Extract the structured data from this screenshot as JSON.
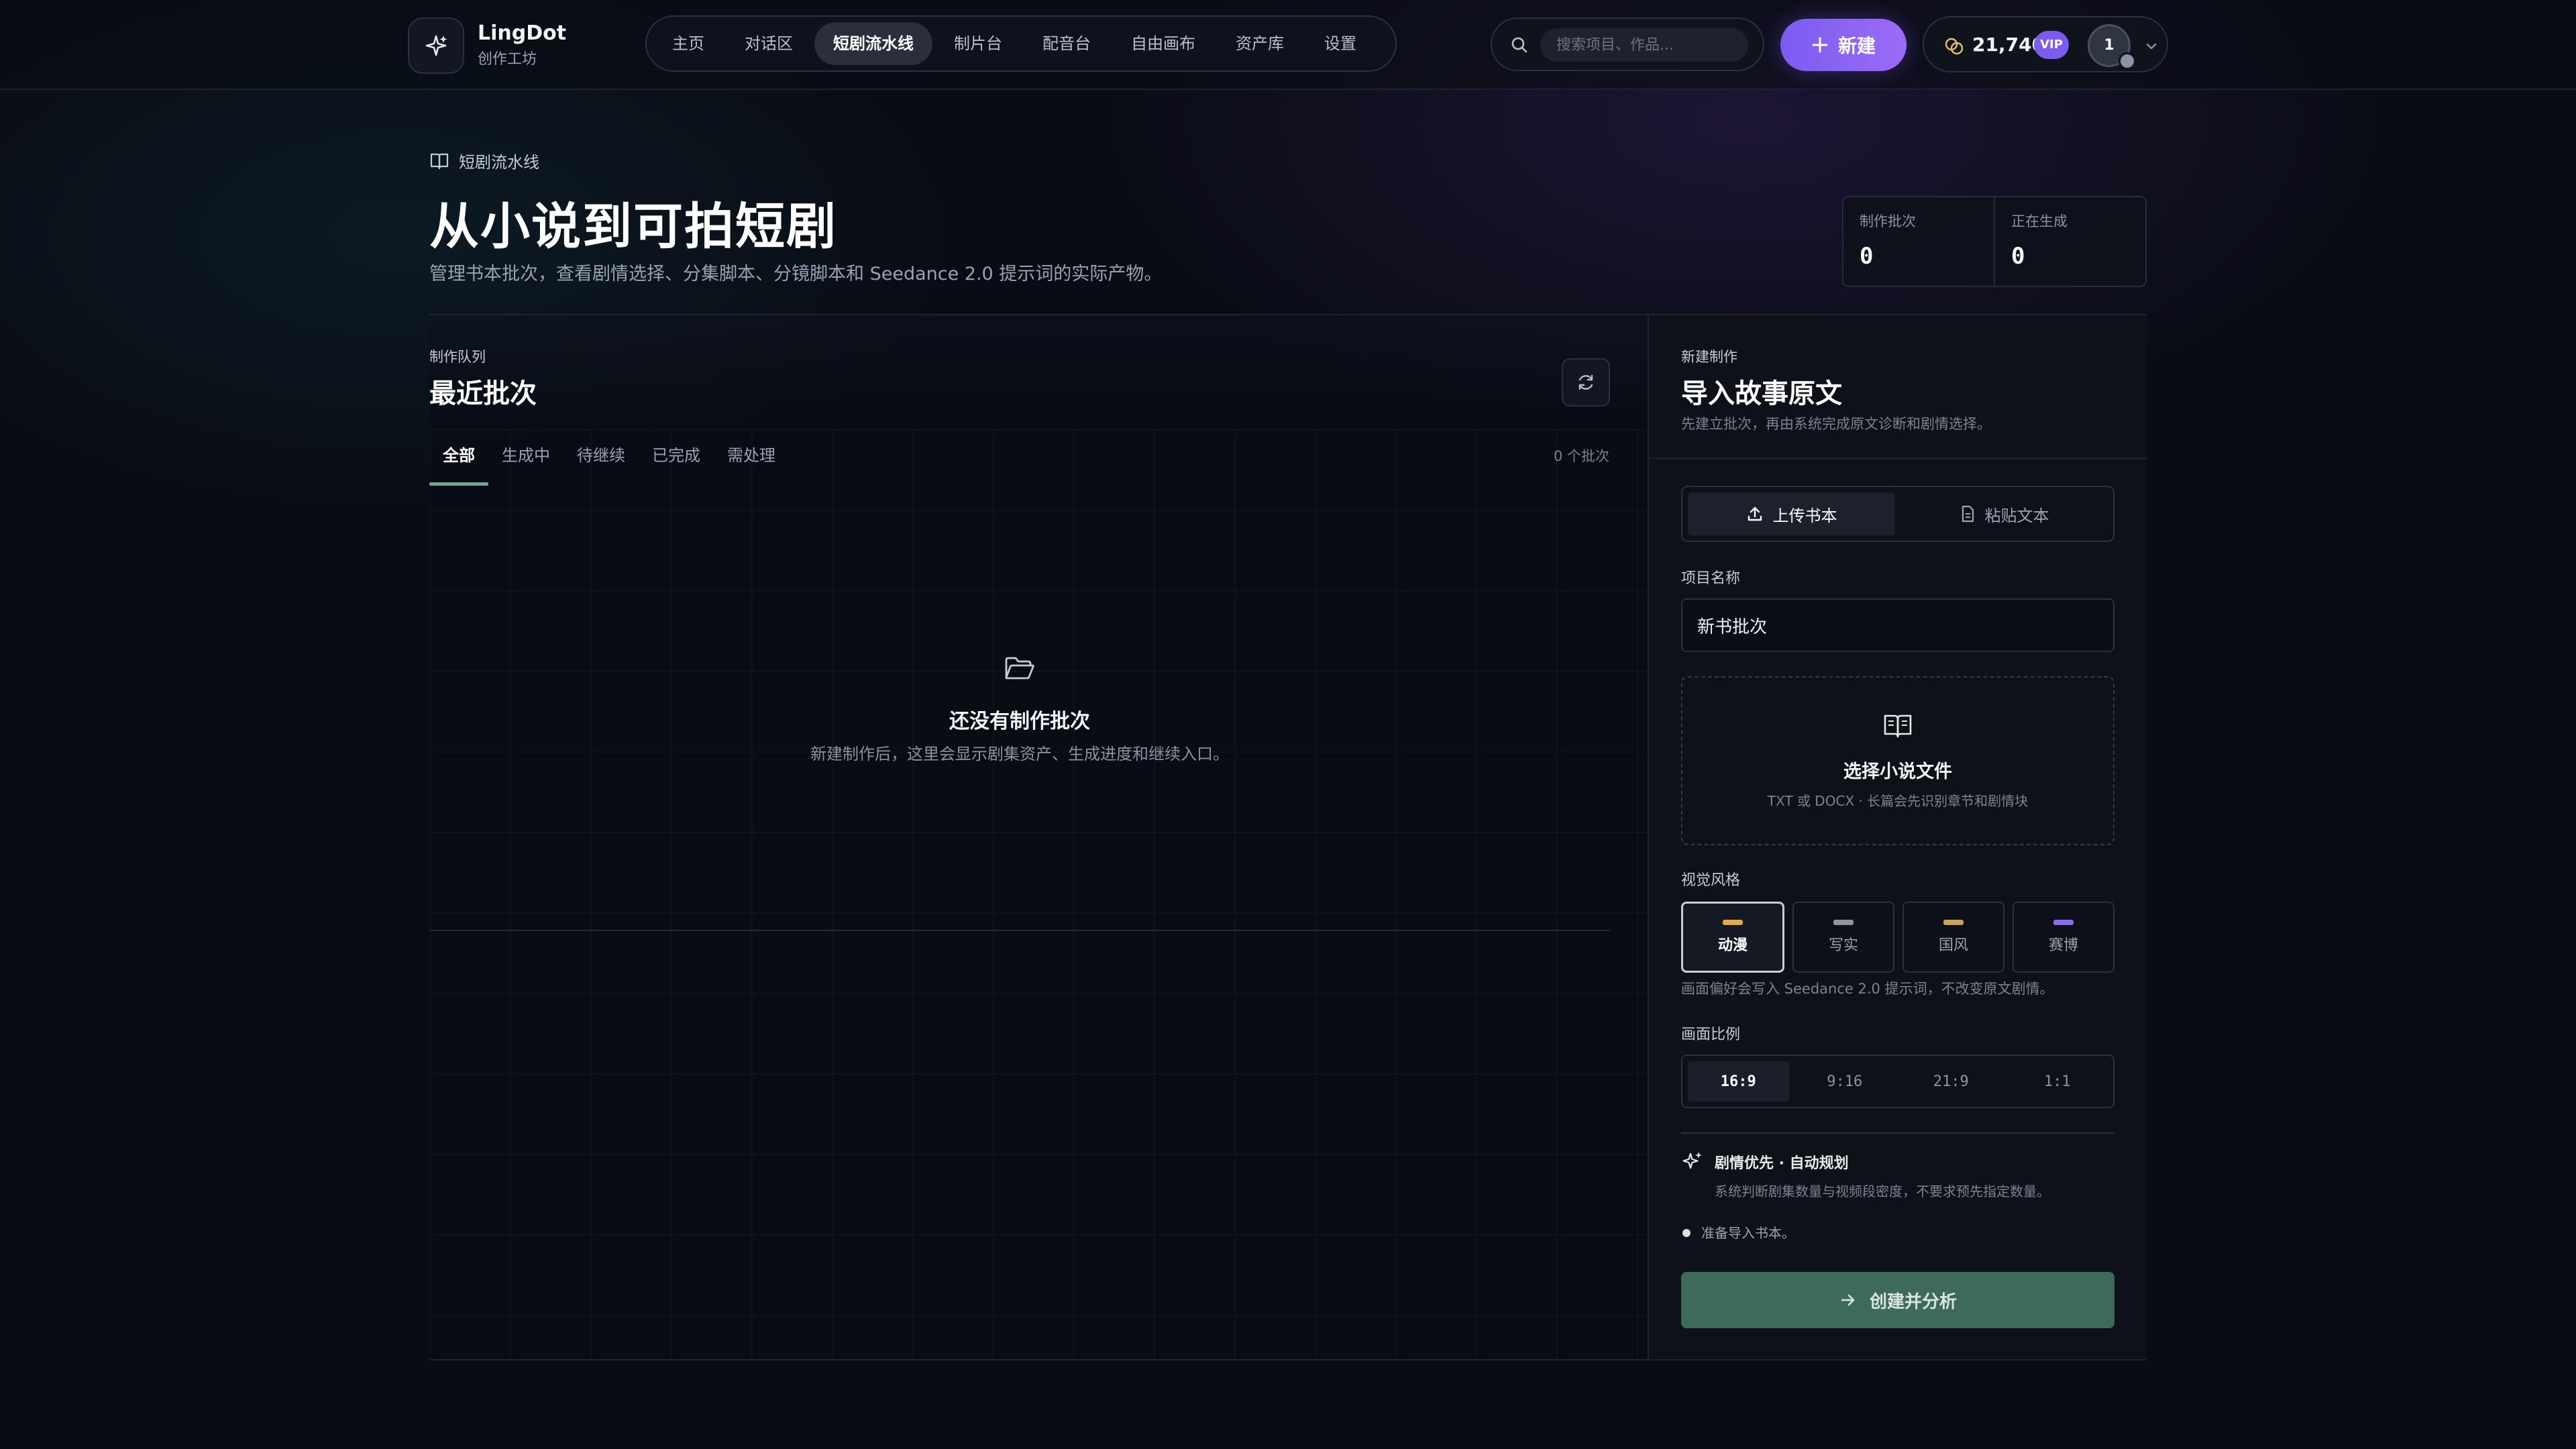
{
  "brand": {
    "name": "LingDot",
    "subtitle": "创作工坊"
  },
  "nav": {
    "items": [
      {
        "label": "主页",
        "active": false
      },
      {
        "label": "对话区",
        "active": false
      },
      {
        "label": "短剧流水线",
        "active": true
      },
      {
        "label": "制片台",
        "active": false
      },
      {
        "label": "配音台",
        "active": false
      },
      {
        "label": "自由画布",
        "active": false
      },
      {
        "label": "资产库",
        "active": false
      },
      {
        "label": "设置",
        "active": false
      }
    ]
  },
  "search": {
    "placeholder": "搜索项目、作品..."
  },
  "new_button": {
    "label": "新建"
  },
  "account": {
    "credits": "21,740",
    "vip_badge": "VIP",
    "avatar_text": "1"
  },
  "header": {
    "breadcrumb": "短剧流水线",
    "title": "从小说到可拍短剧",
    "subtitle": "管理书本批次，查看剧情选择、分集脚本、分镜脚本和 Seedance 2.0 提示词的实际产物。"
  },
  "stats": [
    {
      "label": "制作批次",
      "value": "0"
    },
    {
      "label": "正在生成",
      "value": "0"
    }
  ],
  "queue": {
    "kicker": "制作队列",
    "title": "最近批次",
    "tabs": [
      {
        "label": "全部",
        "active": true
      },
      {
        "label": "生成中",
        "active": false
      },
      {
        "label": "待继续",
        "active": false
      },
      {
        "label": "已完成",
        "active": false
      },
      {
        "label": "需处理",
        "active": false
      }
    ],
    "count_text": "0 个批次",
    "empty_title": "还没有制作批次",
    "empty_subtitle": "新建制作后，这里会显示剧集资产、生成进度和继续入口。"
  },
  "create": {
    "kicker": "新建制作",
    "title": "导入故事原文",
    "subtitle": "先建立批次，再由系统完成原文诊断和剧情选择。",
    "source_tabs": [
      {
        "label": "上传书本",
        "active": true
      },
      {
        "label": "粘贴文本",
        "active": false
      }
    ],
    "project_name_label": "项目名称",
    "project_name_value": "新书批次",
    "dropzone_title": "选择小说文件",
    "dropzone_subtitle": "TXT 或 DOCX · 长篇会先识别章节和剧情块",
    "visual_style_label": "视觉风格",
    "styles": [
      {
        "label": "动漫",
        "color": "#e3a84a",
        "active": true
      },
      {
        "label": "写实",
        "color": "#8f96a3",
        "active": false
      },
      {
        "label": "国风",
        "color": "#c9a25c",
        "active": false
      },
      {
        "label": "赛博",
        "color": "#8b6cf0",
        "active": false
      }
    ],
    "style_hint": "画面偏好会写入 Seedance 2.0 提示词，不改变原文剧情。",
    "ratio_label": "画面比例",
    "ratios": [
      {
        "label": "16:9",
        "active": true
      },
      {
        "label": "9:16",
        "active": false
      },
      {
        "label": "21:9",
        "active": false
      },
      {
        "label": "1:1",
        "active": false
      }
    ],
    "auto_title": "剧情优先 · 自动规划",
    "auto_subtitle": "系统判断剧集数量与视频段密度，不要求预先指定数量。",
    "ready_text": "准备导入书本。",
    "submit_label": "创建并分析"
  }
}
